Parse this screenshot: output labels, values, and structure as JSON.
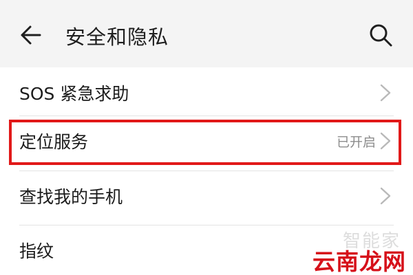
{
  "header": {
    "title": "安全和隐私",
    "back_icon": "arrow-left-icon",
    "search_icon": "search-icon"
  },
  "menu": {
    "items": [
      {
        "label": "SOS 紧急求助",
        "status": ""
      },
      {
        "label": "定位服务",
        "status": "已开启"
      },
      {
        "label": "查找我的手机",
        "status": ""
      },
      {
        "label": "指纹",
        "status": ""
      }
    ]
  },
  "highlight": {
    "color": "#e11919"
  },
  "watermark": {
    "top_text": "智能家",
    "bottom_text": "云南龙网"
  }
}
